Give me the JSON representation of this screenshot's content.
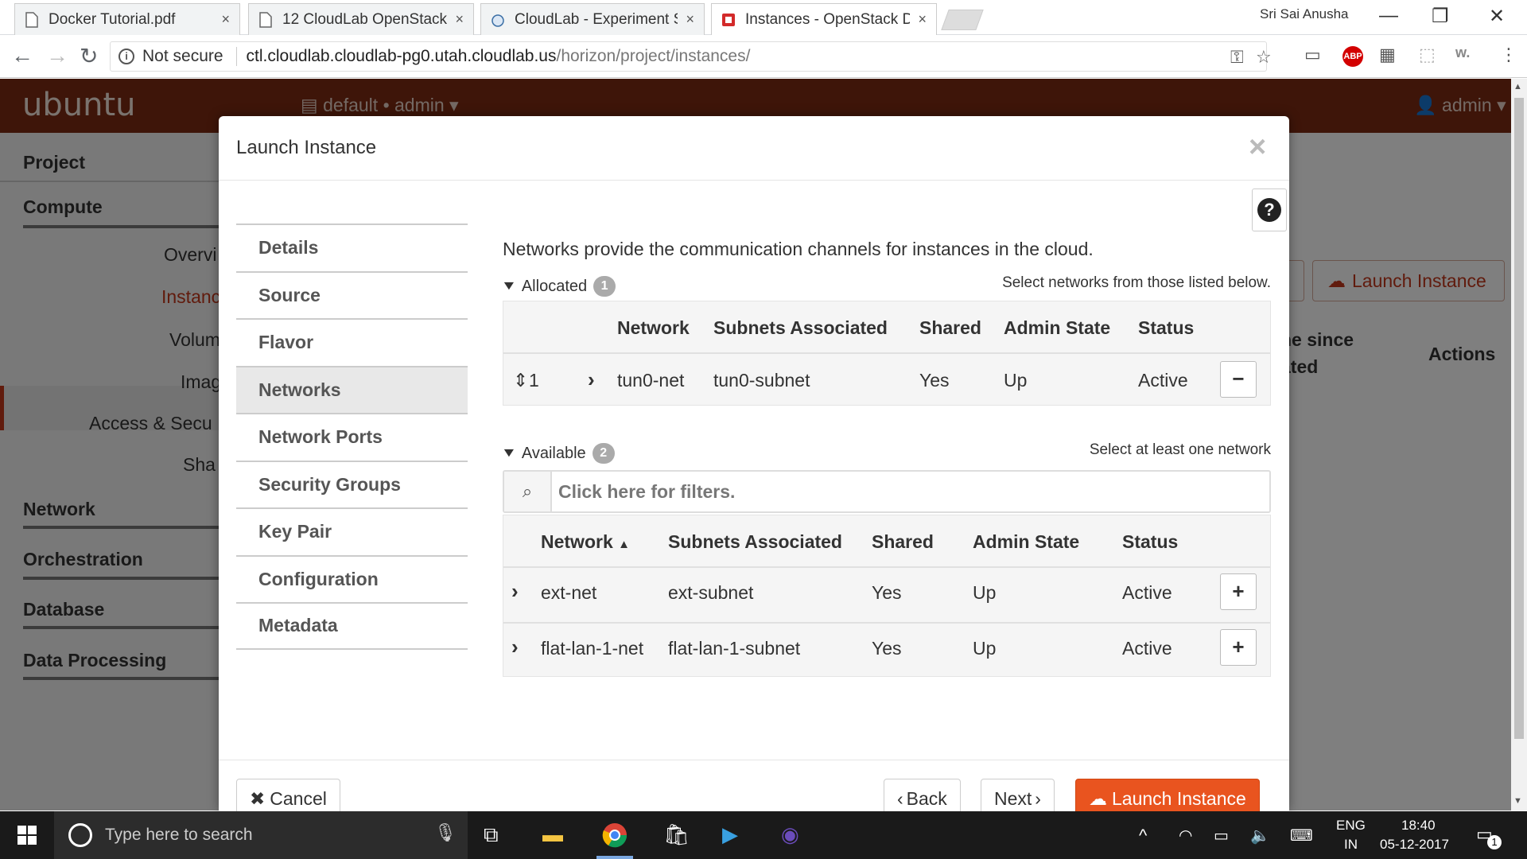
{
  "browser": {
    "tabs": [
      {
        "title": "Docker Tutorial.pdf",
        "close": "×"
      },
      {
        "title": "12 CloudLab OpenStack",
        "close": "×"
      },
      {
        "title": "CloudLab - Experiment S",
        "close": "×"
      },
      {
        "title": "Instances - OpenStack D",
        "close": "×"
      }
    ],
    "profile": "Sri Sai Anusha",
    "window_controls": {
      "minimize": "—",
      "restore": "❐",
      "close": "✕"
    },
    "address": {
      "security": "Not secure",
      "host": "ctl.cloudlab.cloudlab-pg0.utah.cloudlab.us",
      "path": "/horizon/project/instances/"
    },
    "extensions": {
      "abp": "ABP",
      "w": "w."
    }
  },
  "horizon": {
    "logo": "ubuntu",
    "project_selector": "default • admin",
    "user_menu": "admin",
    "sidebar": {
      "categories": [
        "Project",
        "Compute",
        "Network",
        "Orchestration",
        "Database",
        "Data Processing"
      ],
      "compute_items": [
        "Overvi",
        "Instanc",
        "Volum",
        "Imag",
        "Access & Secu",
        "Sha"
      ]
    },
    "main_button": "Launch Instance",
    "table_headers": {
      "since": "ne since",
      "ated": "ated",
      "actions": "Actions"
    }
  },
  "modal": {
    "title": "Launch Instance",
    "close": "×",
    "help": "?",
    "wizard_steps": [
      "Details",
      "Source",
      "Flavor",
      "Networks",
      "Network Ports",
      "Security Groups",
      "Key Pair",
      "Configuration",
      "Metadata"
    ],
    "active_step": "Networks",
    "description": "Networks provide the communication channels for instances in the cloud.",
    "allocated": {
      "label": "Allocated",
      "count": "1",
      "hint": "Select networks from those listed below.",
      "headers": [
        "Network",
        "Subnets Associated",
        "Shared",
        "Admin State",
        "Status"
      ],
      "rows": [
        {
          "order": "1",
          "network": "tun0-net",
          "subnet": "tun0-subnet",
          "shared": "Yes",
          "admin_state": "Up",
          "status": "Active",
          "action": "−"
        }
      ]
    },
    "available": {
      "label": "Available",
      "count": "2",
      "hint": "Select at least one network",
      "filter_placeholder": "Click here for filters.",
      "headers": [
        "Network",
        "Subnets Associated",
        "Shared",
        "Admin State",
        "Status"
      ],
      "rows": [
        {
          "network": "ext-net",
          "subnet": "ext-subnet",
          "shared": "Yes",
          "admin_state": "Up",
          "status": "Active",
          "action": "+"
        },
        {
          "network": "flat-lan-1-net",
          "subnet": "flat-lan-1-subnet",
          "shared": "Yes",
          "admin_state": "Up",
          "status": "Active",
          "action": "+"
        }
      ]
    },
    "footer": {
      "cancel": "Cancel",
      "back": "Back",
      "next": "Next",
      "launch": "Launch Instance"
    }
  },
  "taskbar": {
    "search_placeholder": "Type here to search",
    "lang_top": "ENG",
    "lang_bottom": "IN",
    "time": "18:40",
    "date": "05-12-2017",
    "notifications": "1"
  }
}
